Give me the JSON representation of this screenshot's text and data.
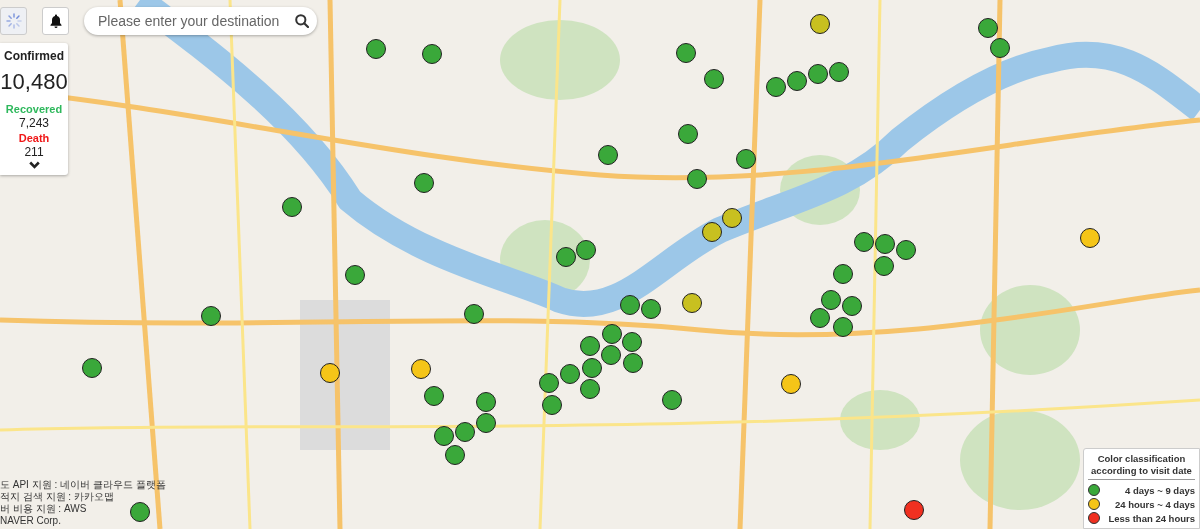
{
  "search": {
    "placeholder": "Please enter your destination"
  },
  "stats": {
    "confirmed_label": "Confirmed",
    "confirmed": "10,480",
    "recovered_label": "Recovered",
    "recovered": "7,243",
    "death_label": "Death",
    "death": "211"
  },
  "legend": {
    "title": "Color classification according to visit date",
    "items": [
      {
        "label": "4 days ~ 9 days",
        "color": "#3aa83a"
      },
      {
        "label": "24 hours ~ 4 days",
        "color": "#f5c518"
      },
      {
        "label": "Less than 24 hours",
        "color": "#f03020"
      }
    ]
  },
  "markers": [
    {
      "color": "#3aa83a"
    },
    {
      "color": "#3aa83a"
    },
    {
      "color": "#3aa83a"
    },
    {
      "color": "#3aa83a"
    },
    {
      "color": "#3aa83a"
    },
    {
      "color": "#3aa83a"
    },
    {
      "color": "#3aa83a"
    },
    {
      "color": "#3aa83a"
    },
    {
      "color": "#3aa83a"
    },
    {
      "color": "#3aa83a"
    },
    {
      "color": "#3aa83a"
    },
    {
      "color": "#3aa83a"
    },
    {
      "color": "#3aa83a"
    },
    {
      "color": "#3aa83a"
    },
    {
      "color": "#3aa83a"
    },
    {
      "color": "#3aa83a"
    },
    {
      "color": "#3aa83a"
    },
    {
      "color": "#3aa83a"
    },
    {
      "color": "#3aa83a"
    },
    {
      "color": "#3aa83a"
    },
    {
      "color": "#3aa83a"
    },
    {
      "color": "#3aa83a"
    },
    {
      "color": "#3aa83a"
    },
    {
      "color": "#3aa83a"
    },
    {
      "color": "#3aa83a"
    },
    {
      "color": "#3aa83a"
    },
    {
      "color": "#3aa83a"
    },
    {
      "color": "#3aa83a"
    },
    {
      "color": "#3aa83a"
    },
    {
      "color": "#3aa83a"
    },
    {
      "color": "#3aa83a"
    },
    {
      "color": "#3aa83a"
    },
    {
      "color": "#3aa83a"
    },
    {
      "color": "#3aa83a"
    },
    {
      "color": "#3aa83a"
    },
    {
      "color": "#3aa83a"
    },
    {
      "color": "#3aa83a"
    },
    {
      "color": "#3aa83a"
    },
    {
      "color": "#3aa83a"
    },
    {
      "color": "#3aa83a"
    },
    {
      "color": "#3aa83a"
    },
    {
      "color": "#3aa83a"
    },
    {
      "color": "#3aa83a"
    },
    {
      "color": "#3aa83a"
    },
    {
      "color": "#3aa83a"
    },
    {
      "color": "#3aa83a"
    },
    {
      "color": "#3aa83a"
    },
    {
      "color": "#3aa83a"
    },
    {
      "color": "#3aa83a"
    },
    {
      "color": "#3aa83a"
    },
    {
      "color": "#3aa83a"
    },
    {
      "color": "#c8c020"
    },
    {
      "color": "#c8c020"
    },
    {
      "color": "#c8c020"
    },
    {
      "color": "#c8c020"
    },
    {
      "color": "#f5c518"
    },
    {
      "color": "#f5c518"
    },
    {
      "color": "#f5c518"
    },
    {
      "color": "#f5c518"
    },
    {
      "color": "#f03020"
    }
  ],
  "attribution": [
    "도 API 지원 : 네이버 클라우드 플랫폼",
    "적지 검색 지원 : 카카오맵",
    "버 비용 지원 : AWS",
    "NAVER Corp."
  ]
}
